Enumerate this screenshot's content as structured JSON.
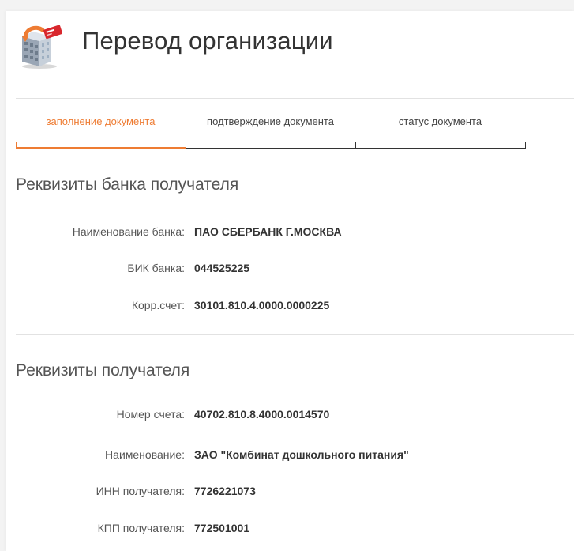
{
  "header": {
    "title": "Перевод организации",
    "icon": "building-transfer-icon"
  },
  "steps": [
    {
      "label": "заполнение документа",
      "state": "active"
    },
    {
      "label": "подтверждение документа",
      "state": "inactive"
    },
    {
      "label": "статус документа",
      "state": "inactive"
    }
  ],
  "bank_section": {
    "title": "Реквизиты банка получателя",
    "fields": [
      {
        "label": "Наименование банка:",
        "value": "ПАО СБЕРБАНК Г.МОСКВА"
      },
      {
        "label": "БИК банка:",
        "value": "044525225"
      },
      {
        "label": "Корр.счет:",
        "value": "30101.810.4.0000.0000225"
      }
    ]
  },
  "recipient_section": {
    "title": "Реквизиты получателя",
    "fields": [
      {
        "label": "Номер счета:",
        "value": "40702.810.8.4000.0014570"
      },
      {
        "label": "Наименование:",
        "value": "ЗАО \"Комбинат дошкольного питания\""
      },
      {
        "label": "ИНН получателя:",
        "value": "7726221073"
      },
      {
        "label": "КПП получателя:",
        "value": "772501001"
      }
    ]
  },
  "colors": {
    "accent": "#ee7c33",
    "text": "#333333",
    "muted": "#555555",
    "divider": "#e2e2e2"
  }
}
